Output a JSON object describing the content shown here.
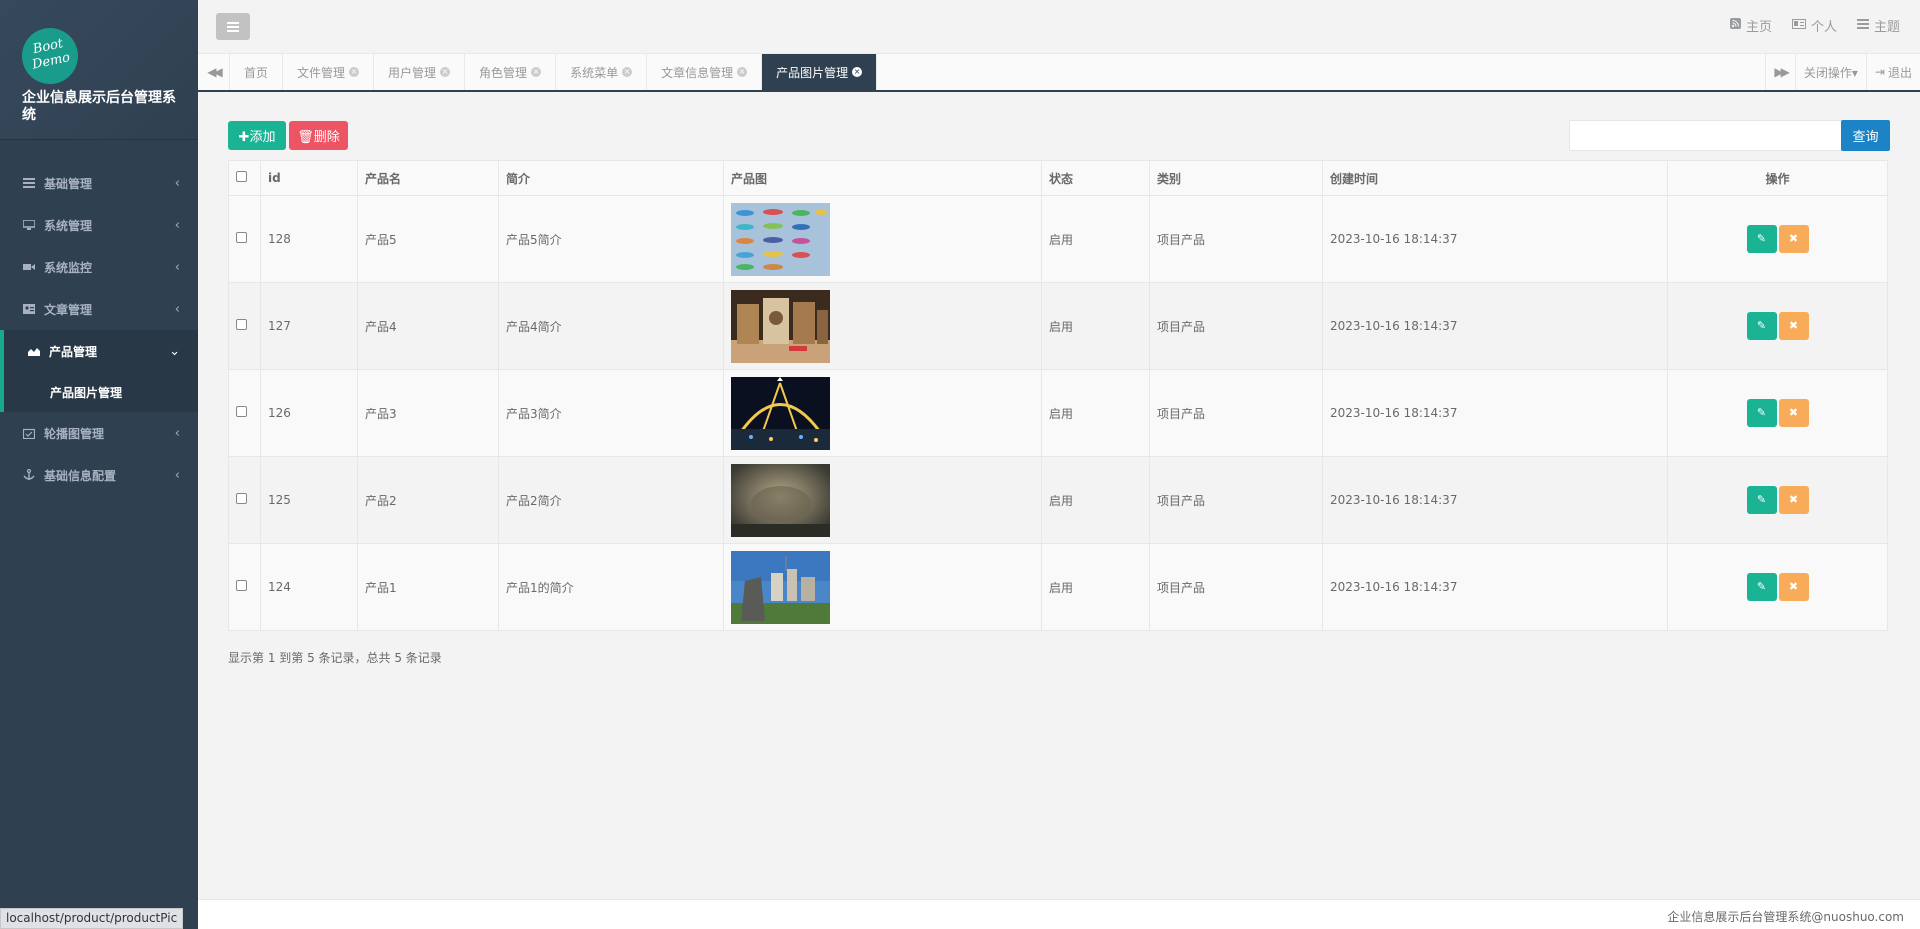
{
  "app": {
    "logo_text_1": "Boot",
    "logo_text_2": "Demo",
    "title": "企业信息展示后台管理系统"
  },
  "sidebar": {
    "items": [
      {
        "label": "基础管理",
        "icon": "list-icon"
      },
      {
        "label": "系统管理",
        "icon": "desktop-icon"
      },
      {
        "label": "系统监控",
        "icon": "video-camera-icon"
      },
      {
        "label": "文章管理",
        "icon": "id-card-icon"
      },
      {
        "label": "产品管理",
        "icon": "area-chart-icon",
        "active": true,
        "children": [
          {
            "label": "产品图片管理"
          }
        ]
      },
      {
        "label": "轮播图管理",
        "icon": "calendar-check-icon"
      },
      {
        "label": "基础信息配置",
        "icon": "anchor-icon"
      }
    ]
  },
  "topbar": {
    "links": [
      {
        "label": "主页",
        "icon": "rss-icon"
      },
      {
        "label": "个人",
        "icon": "id-card-icon"
      },
      {
        "label": "主题",
        "icon": "list-icon"
      }
    ]
  },
  "tabs": {
    "items": [
      "首页",
      "文件管理",
      "用户管理",
      "角色管理",
      "系统菜单",
      "文章信息管理",
      "产品图片管理"
    ],
    "active_index": 6,
    "close_ops": "关闭操作▾",
    "logout": "退出"
  },
  "toolbar": {
    "add_label": "✚添加",
    "delete_label": "🗑删除",
    "search_value": "",
    "query_label": "查询"
  },
  "table": {
    "columns": [
      "id",
      "产品名",
      "简介",
      "产品图",
      "状态",
      "类别",
      "创建时间",
      "操作"
    ],
    "rows": [
      {
        "id": "128",
        "name": "产品5",
        "intro": "产品5简介",
        "status": "启用",
        "category": "项目产品",
        "created": "2023-10-16 18:14:37"
      },
      {
        "id": "127",
        "name": "产品4",
        "intro": "产品4简介",
        "status": "启用",
        "category": "项目产品",
        "created": "2023-10-16 18:14:37"
      },
      {
        "id": "126",
        "name": "产品3",
        "intro": "产品3简介",
        "status": "启用",
        "category": "项目产品",
        "created": "2023-10-16 18:14:37"
      },
      {
        "id": "125",
        "name": "产品2",
        "intro": "产品2简介",
        "status": "启用",
        "category": "项目产品",
        "created": "2023-10-16 18:14:37"
      },
      {
        "id": "124",
        "name": "产品1",
        "intro": "产品1的简介",
        "status": "启用",
        "category": "项目产品",
        "created": "2023-10-16 18:14:37"
      }
    ]
  },
  "pagination": {
    "info": "显示第 1 到第 5 条记录，总共 5 条记录"
  },
  "footer": {
    "text": "企业信息展示后台管理系统@nuoshuo.com"
  },
  "statusbar": {
    "url": "localhost/product/productPic"
  },
  "colors": {
    "sidebar_bg": "#2f4050",
    "accent_green": "#1ab394",
    "danger_red": "#ed5565",
    "warning_orange": "#f8ac59",
    "primary_blue": "#1c84c6"
  }
}
